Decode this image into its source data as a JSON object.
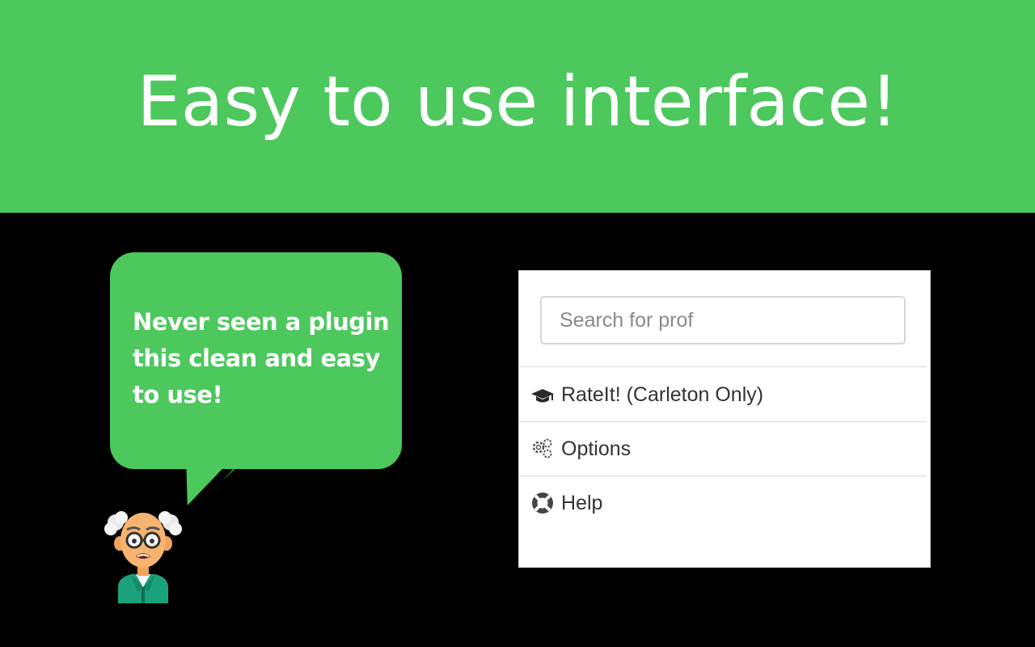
{
  "banner": {
    "title": "Easy to use interface!",
    "background": "#4cc85d"
  },
  "speech_bubble": {
    "text": "Never seen a plugin this clean and easy to use!",
    "background": "#4cc85d"
  },
  "character": {
    "icon": "old-professor-icon"
  },
  "popup": {
    "search": {
      "placeholder": "Search for prof",
      "value": ""
    },
    "menu": [
      {
        "icon": "graduation-cap-icon",
        "label": "RateIt! (Carleton Only)"
      },
      {
        "icon": "gears-icon",
        "label": "Options"
      },
      {
        "icon": "lifebuoy-icon",
        "label": "Help"
      }
    ]
  }
}
